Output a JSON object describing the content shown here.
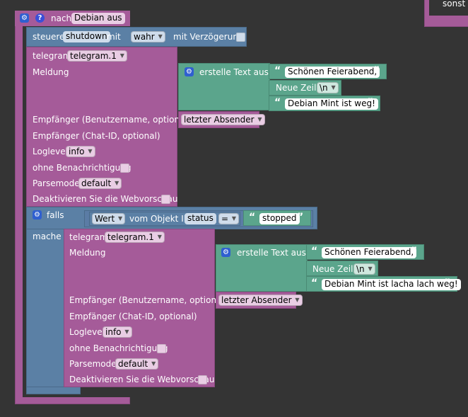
{
  "top_right": {
    "else_label": "sonst"
  },
  "timeout_block": {
    "label": "nach",
    "value": "Debian aus"
  },
  "control_block": {
    "label": "steuere",
    "object": "shutdown",
    "with_label": "mit",
    "value": "wahr",
    "delay_label": "mit Verzögerung"
  },
  "telegram1": {
    "label": "telegram",
    "instance": "telegram.1",
    "message_label": "Meldung",
    "text_block": {
      "label": "erstelle Text aus",
      "line1": "Schönen Feierabend,",
      "newline_label": "Neue Zeile",
      "newline_value": "\\n",
      "line3": "Debian Mint ist weg!"
    },
    "recipient_user_label": "Empfänger (Benutzername, optional)",
    "recipient_user_value": "letzter Absender",
    "recipient_chat_label": "Empfänger (Chat-ID, optional)",
    "loglevel_label": "Loglevel",
    "loglevel_value": "info",
    "silent_label": "ohne Benachrichtigung",
    "parsemode_label": "Parsemode",
    "parsemode_value": "default",
    "preview_label": "Deaktivieren Sie die Webvorschau"
  },
  "if_block": {
    "label": "falls",
    "value_label": "Wert",
    "object_label": "vom Objekt ID",
    "object_value": "status",
    "operator": "=",
    "compare_value": "stopped",
    "do_label": "mache"
  },
  "telegram2": {
    "label": "telegram",
    "instance": "telegram.1",
    "message_label": "Meldung",
    "text_block": {
      "label": "erstelle Text aus",
      "line1": "Schönen Feierabend,",
      "newline_label": "Neue Zeile",
      "newline_value": "\\n",
      "line3": "Debian Mint ist lacha lach weg!"
    },
    "recipient_user_label": "Empfänger (Benutzername, optional)",
    "recipient_user_value": "letzter Absender",
    "recipient_chat_label": "Empfänger (Chat-ID, optional)",
    "loglevel_label": "Loglevel",
    "loglevel_value": "info",
    "silent_label": "ohne Benachrichtigung",
    "parsemode_label": "Parsemode",
    "parsemode_value": "default",
    "preview_label": "Deaktivieren Sie die Webvorschau"
  }
}
